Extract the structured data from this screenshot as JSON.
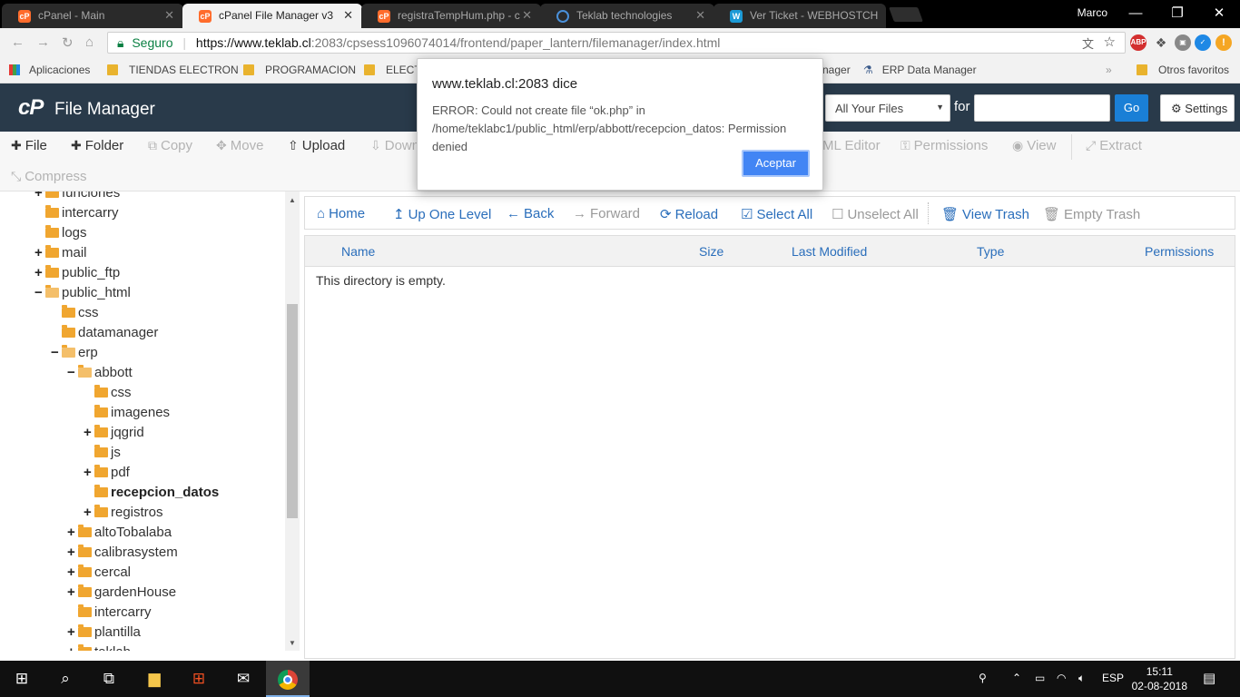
{
  "browser": {
    "tabs": [
      {
        "title": "cPanel - Main",
        "icon": "cpanel-favicon"
      },
      {
        "title": "cPanel File Manager v3",
        "icon": "cpanel-favicon",
        "active": true
      },
      {
        "title": "registraTempHum.php - c",
        "icon": "cpanel-favicon"
      },
      {
        "title": "Teklab technologies",
        "icon": "loading-favicon"
      },
      {
        "title": "Ver Ticket - WEBHOSTCH",
        "icon": "whmcs-favicon"
      }
    ],
    "user": "Marco",
    "secure_label": "Seguro",
    "url_host": "https://www.teklab.cl",
    "url_path": ":2083/cpsess1096074014/frontend/paper_lantern/filemanager/index.html",
    "bookmarks": [
      "Aplicaciones",
      "TIENDAS ELECTRON",
      "PROGRAMACION",
      "ELECT",
      "nager",
      "ERP Data Manager"
    ],
    "other_bookmarks": "Otros favoritos"
  },
  "cpanel": {
    "logo": "cP",
    "title": "File Manager",
    "search_scope": "All Your Files",
    "search_for": "for",
    "go": "Go",
    "settings": "Settings"
  },
  "toolbar": {
    "file": "File",
    "folder": "Folder",
    "copy": "Copy",
    "move": "Move",
    "upload": "Upload",
    "download": "Down",
    "html_editor": "ML Editor",
    "permissions": "Permissions",
    "view": "View",
    "extract": "Extract",
    "compress": "Compress"
  },
  "tree": [
    {
      "label": "funciones",
      "toggle": "+",
      "open": false
    },
    {
      "label": "intercarry",
      "toggle": "",
      "open": false
    },
    {
      "label": "logs",
      "toggle": "",
      "open": false
    },
    {
      "label": "mail",
      "toggle": "+",
      "open": false
    },
    {
      "label": "public_ftp",
      "toggle": "+",
      "open": false
    },
    {
      "label": "public_html",
      "toggle": "−",
      "open": true
    },
    {
      "label": "css",
      "toggle": "",
      "open": false
    },
    {
      "label": "datamanager",
      "toggle": "",
      "open": false
    },
    {
      "label": "erp",
      "toggle": "−",
      "open": true
    },
    {
      "label": "abbott",
      "toggle": "−",
      "open": true
    },
    {
      "label": "css",
      "toggle": "",
      "open": false
    },
    {
      "label": "imagenes",
      "toggle": "",
      "open": false
    },
    {
      "label": "jqgrid",
      "toggle": "+",
      "open": false
    },
    {
      "label": "js",
      "toggle": "",
      "open": false
    },
    {
      "label": "pdf",
      "toggle": "+",
      "open": false
    },
    {
      "label": "recepcion_datos",
      "toggle": "",
      "open": false,
      "selected": true
    },
    {
      "label": "registros",
      "toggle": "+",
      "open": false
    },
    {
      "label": "altoTobalaba",
      "toggle": "+",
      "open": false
    },
    {
      "label": "calibrasystem",
      "toggle": "+",
      "open": false
    },
    {
      "label": "cercal",
      "toggle": "+",
      "open": false
    },
    {
      "label": "gardenHouse",
      "toggle": "+",
      "open": false
    },
    {
      "label": "intercarry",
      "toggle": "",
      "open": false
    },
    {
      "label": "plantilla",
      "toggle": "+",
      "open": false
    },
    {
      "label": "teklab",
      "toggle": "+",
      "open": false
    }
  ],
  "nav": {
    "home": "Home",
    "up": "Up One Level",
    "back": "Back",
    "forward": "Forward",
    "reload": "Reload",
    "select_all": "Select All",
    "unselect_all": "Unselect All",
    "view_trash": "View Trash",
    "empty_trash": "Empty Trash"
  },
  "columns": {
    "name": "Name",
    "size": "Size",
    "modified": "Last Modified",
    "type": "Type",
    "permissions": "Permissions"
  },
  "empty_message": "This directory is empty.",
  "dialog": {
    "title": "www.teklab.cl:2083 dice",
    "message": "ERROR: Could not create file “ok.php” in /home/teklabc1/public_html/erp/abbott/recepcion_datos: Permission denied",
    "button": "Aceptar"
  },
  "taskbar": {
    "language": "ESP",
    "time": "15:11",
    "date": "02-08-2018"
  },
  "colors": {
    "cpanel_header": "#293a4a",
    "link_blue": "#2a6ebb",
    "go_button": "#1a7fd6",
    "dialog_button": "#4285f4",
    "folder": "#f0a630"
  }
}
